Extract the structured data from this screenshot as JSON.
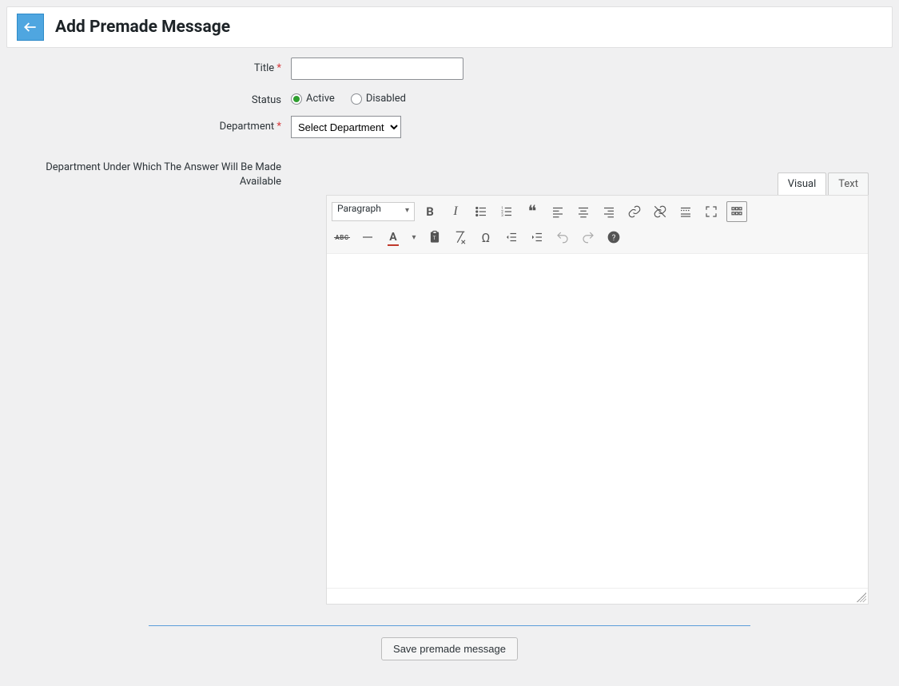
{
  "header": {
    "title": "Add Premade Message"
  },
  "form": {
    "title_label": "Title",
    "title_value": "",
    "status_label": "Status",
    "status_options": {
      "active": "Active",
      "disabled": "Disabled"
    },
    "status_value": "active",
    "dept_label": "Department",
    "dept_placeholder": "Select Department",
    "dept_help": "Department Under Which The Answer Will Be Made Available"
  },
  "editor": {
    "tabs": {
      "visual": "Visual",
      "text": "Text"
    },
    "active_tab": "visual",
    "format_label": "Paragraph",
    "content": ""
  },
  "actions": {
    "save": "Save premade message"
  }
}
